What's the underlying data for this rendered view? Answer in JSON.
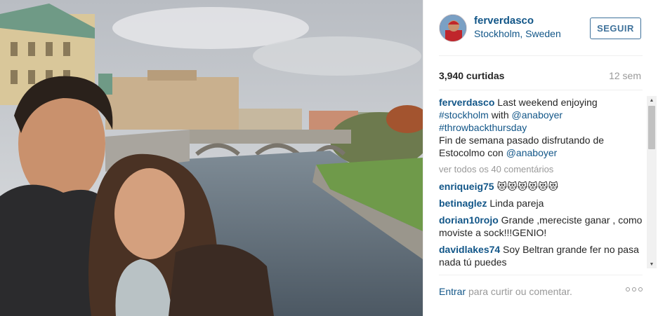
{
  "post": {
    "username": "ferverdasco",
    "location": "Stockholm, Sweden",
    "follow_label": "SEGUIR",
    "likes": "3,940 curtidas",
    "age": "12 sem"
  },
  "caption": {
    "user": "ferverdasco",
    "text_1": " Last weekend enjoying ",
    "tag_1": "#stockholm",
    "text_2": " with ",
    "mention_1": "@anaboyer",
    "tag_2": "#throwbackthursday",
    "text_3": "Fin de semana pasado disfrutando de Estocolmo con ",
    "mention_2": "@anaboyer"
  },
  "view_all": "ver todos os 40 comentários",
  "comments": [
    {
      "user": "enriqueig75",
      "text": " 😻😻😻😻😻😻"
    },
    {
      "user": "betinaglez",
      "text": " Linda pareja"
    },
    {
      "user": "dorian10rojo",
      "text": " Grande ,mereciste ganar , como moviste a sock!!!GENIO!"
    },
    {
      "user": "davidlakes74",
      "text": " Soy Beltran grande fer no pasa nada tú puedes"
    }
  ],
  "footer": {
    "login_link": "Entrar",
    "login_text": " para curtir ou comentar."
  },
  "icons": {
    "more_options": "more-options-icon",
    "avatar": "avatar"
  }
}
